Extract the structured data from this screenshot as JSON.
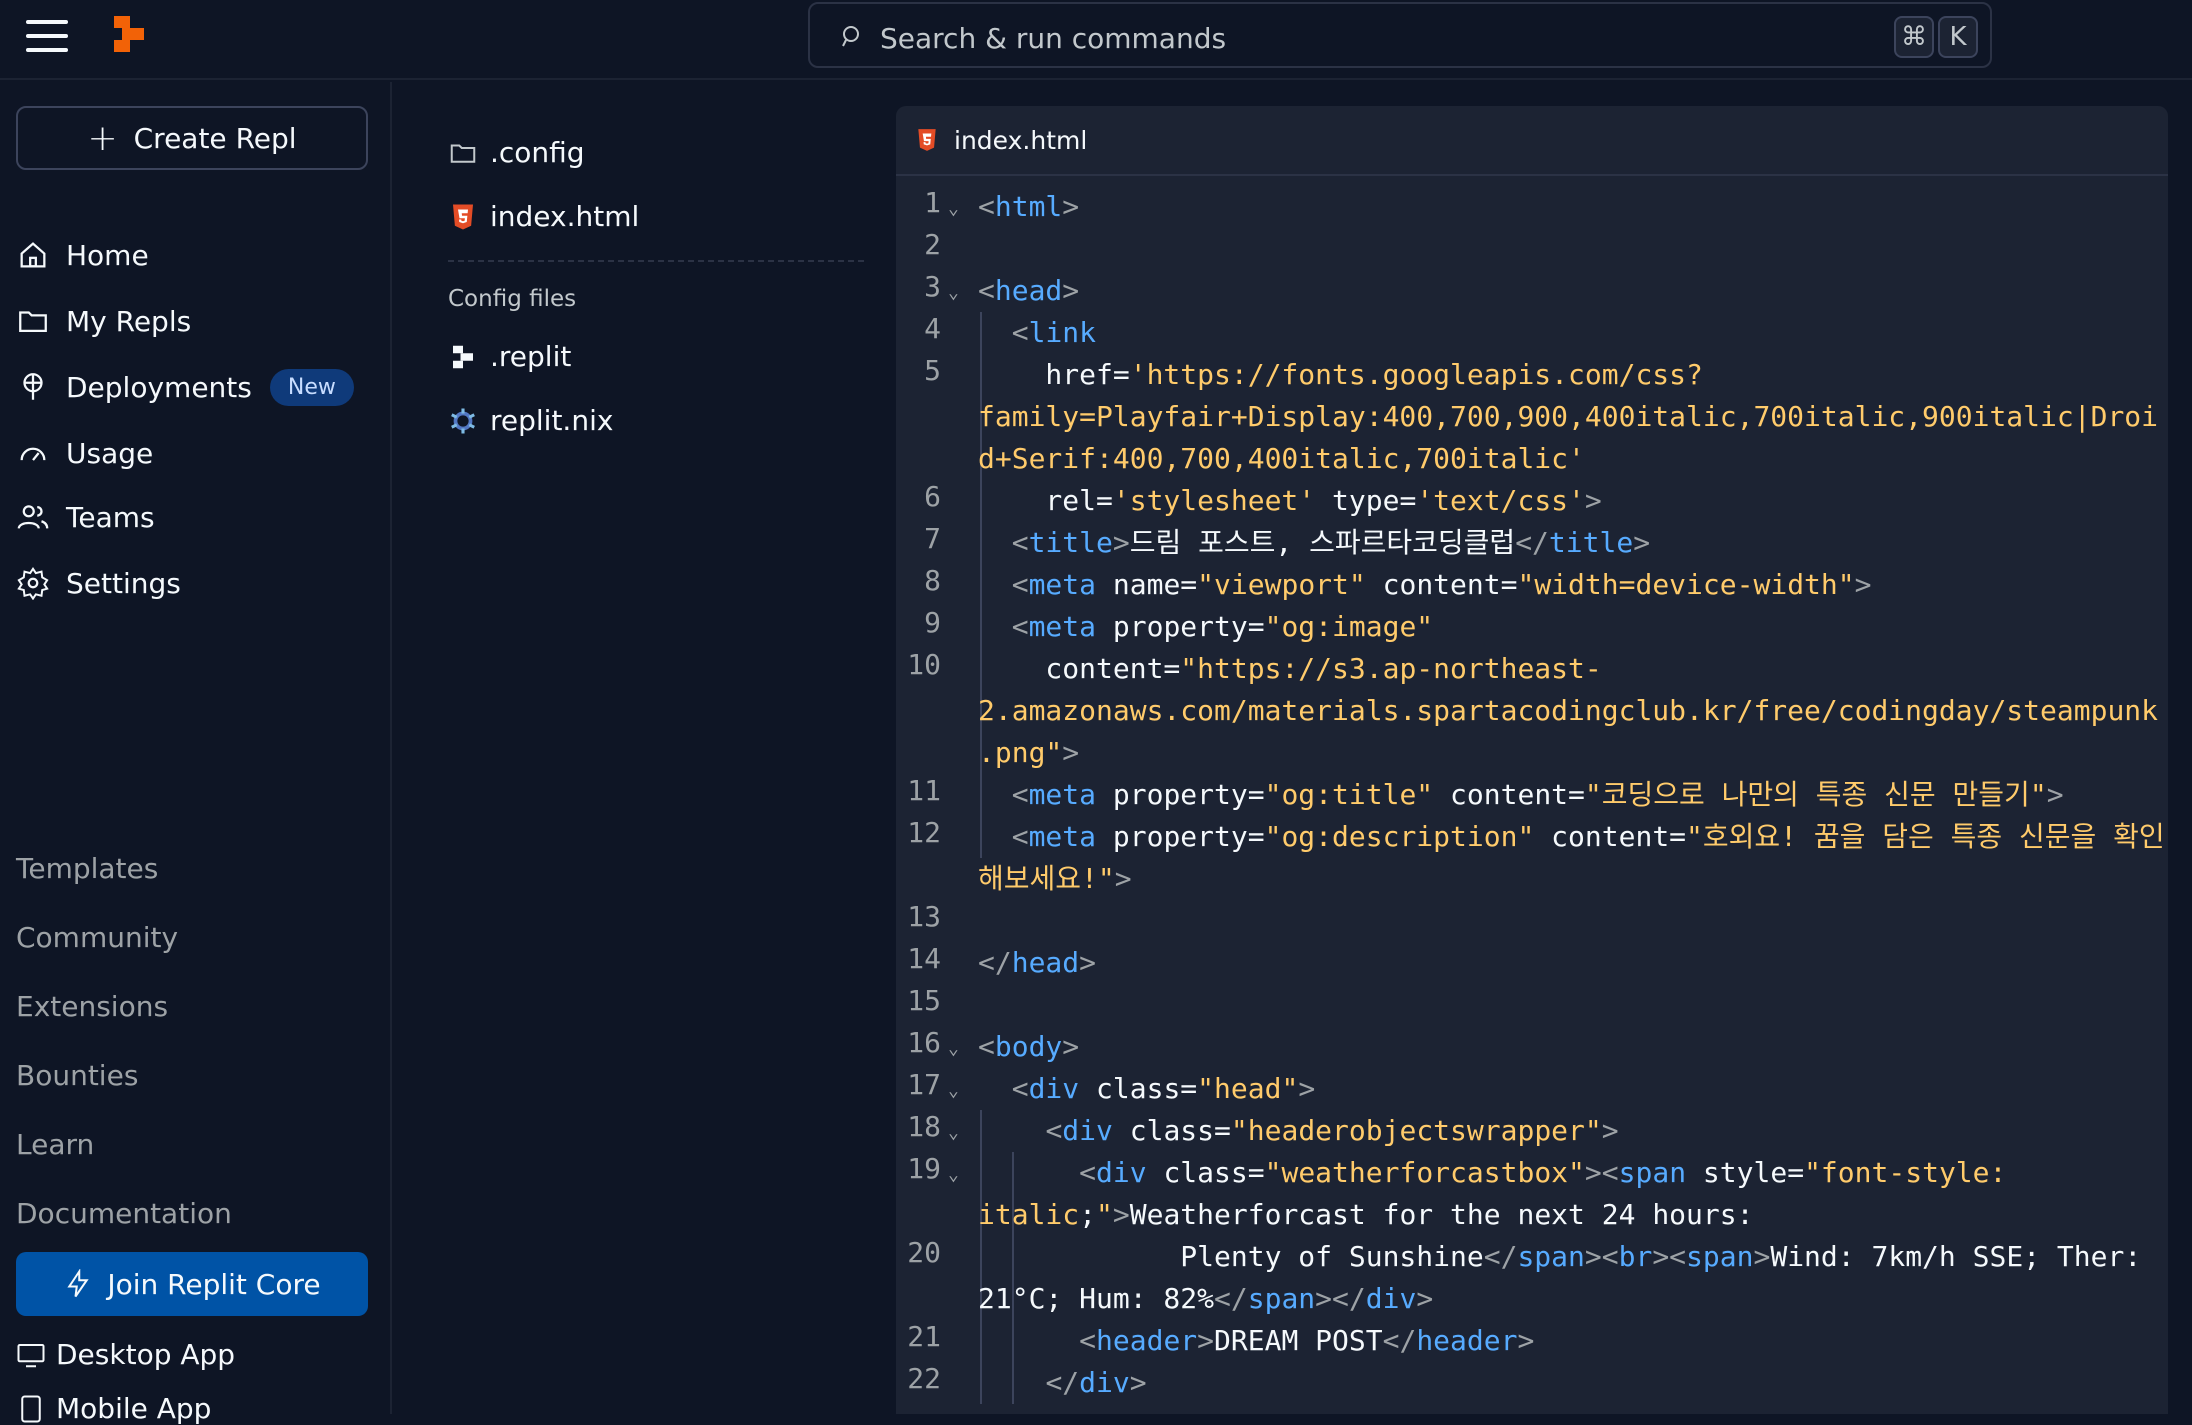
{
  "topbar": {
    "search_placeholder": "Search & run commands",
    "shortcut_mod": "⌘",
    "shortcut_key": "K"
  },
  "sidebar": {
    "create_label": "Create Repl",
    "nav": [
      {
        "label": "Home",
        "icon": "home-icon"
      },
      {
        "label": "My Repls",
        "icon": "folder-icon"
      },
      {
        "label": "Deployments",
        "icon": "deployments-icon",
        "badge": "New"
      },
      {
        "label": "Usage",
        "icon": "gauge-icon"
      },
      {
        "label": "Teams",
        "icon": "users-icon"
      },
      {
        "label": "Settings",
        "icon": "gear-icon"
      }
    ],
    "secondary": [
      "Templates",
      "Community",
      "Extensions",
      "Bounties",
      "Learn",
      "Documentation"
    ],
    "cta_label": "Join Replit Core",
    "apps": [
      "Desktop App",
      "Mobile App"
    ]
  },
  "files": {
    "items": [
      {
        "name": ".config",
        "icon": "folder-icon"
      },
      {
        "name": "index.html",
        "icon": "html5-icon"
      }
    ],
    "config_label": "Config files",
    "config_items": [
      {
        "name": ".replit",
        "icon": "replit-icon"
      },
      {
        "name": "replit.nix",
        "icon": "nix-icon"
      }
    ]
  },
  "editor": {
    "tab_label": "index.html",
    "line_numbers": [
      "1",
      "2",
      "3",
      "4",
      "5",
      "6",
      "7",
      "8",
      "9",
      "10",
      "11",
      "12",
      "13",
      "14",
      "15",
      "16",
      "17",
      "18",
      "19",
      "20",
      "21",
      "22"
    ],
    "lines": [
      "<html>",
      "",
      "<head>",
      "  <link",
      "    href='https://fonts.googleapis.com/css?",
      "family=Playfair+Display:400,700,900,400italic,700italic,900italic|Droi",
      "d+Serif:400,700,400italic,700italic'",
      "    rel='stylesheet' type='text/css'>",
      "  <title>드림 포스트, 스파르타코딩클럽</title>",
      "  <meta name=\"viewport\" content=\"width=device-width\">",
      "  <meta property=\"og:image\"",
      "    content=\"https://s3.ap-northeast-",
      "2.amazonaws.com/materials.spartacodingclub.kr/free/codingday/steampunk",
      ".png\">",
      "  <meta property=\"og:title\" content=\"코딩으로 나만의 특종 신문 만들기\">",
      "  <meta property=\"og:description\" content=\"호외요! 꿈을 담은 특종 신문을 확인",
      "해보세요!\">",
      "",
      "</head>",
      "",
      "<body>",
      "  <div class=\"head\">",
      "    <div class=\"headerobjectswrapper\">",
      "      <div class=\"weatherforcastbox\"><span style=\"font-style:",
      "italic;\">Weatherforcast for the next 24 hours:",
      "            Plenty of Sunshine</span><br><span>Wind: 7km/h SSE; Ther:",
      "21°C; Hum: 82%</span></div>",
      "      <header>DREAM POST</header>",
      "    </div>"
    ]
  }
}
